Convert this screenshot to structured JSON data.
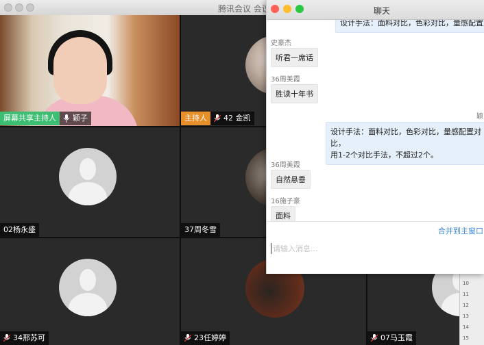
{
  "main_window": {
    "title": "腾讯会议 会议"
  },
  "tiles": [
    {
      "badge": "屏幕共享主持人",
      "name": "颖子"
    },
    {
      "badge": "主持人",
      "name": "42 金凯"
    },
    {
      "name": "02杨永盛"
    },
    {
      "name": "37周冬雪"
    },
    {
      "name": "34邢苏可"
    },
    {
      "name": "23任婷婷"
    },
    {
      "name": "07马玉霞"
    }
  ],
  "chat": {
    "title": "聊天",
    "messages": [
      {
        "sender": "",
        "text": "设计手法：面料对比，色彩对比，量感配置对比，"
      },
      {
        "sender": "史豪杰",
        "text": "听君一席话"
      },
      {
        "sender": "36周美霞",
        "text": "胜读十年书"
      },
      {
        "sender": "颖",
        "text": "设计手法：面料对比，色彩对比，量感配置对比，\n用1-2个对比手法，不超过2个。"
      },
      {
        "sender": "36周美霞",
        "text": "自然悬垂"
      },
      {
        "sender": "16施子豪",
        "text": "面料"
      }
    ],
    "merge_link": "合并到主窗口",
    "input_placeholder": "请输入消息..."
  },
  "ruler": {
    "numbers": [
      "10",
      "11",
      "12",
      "13",
      "14",
      "15"
    ]
  },
  "colors": {
    "host_badge": "#e7902a",
    "share_badge": "#3cbf73",
    "link": "#3b86d8"
  }
}
